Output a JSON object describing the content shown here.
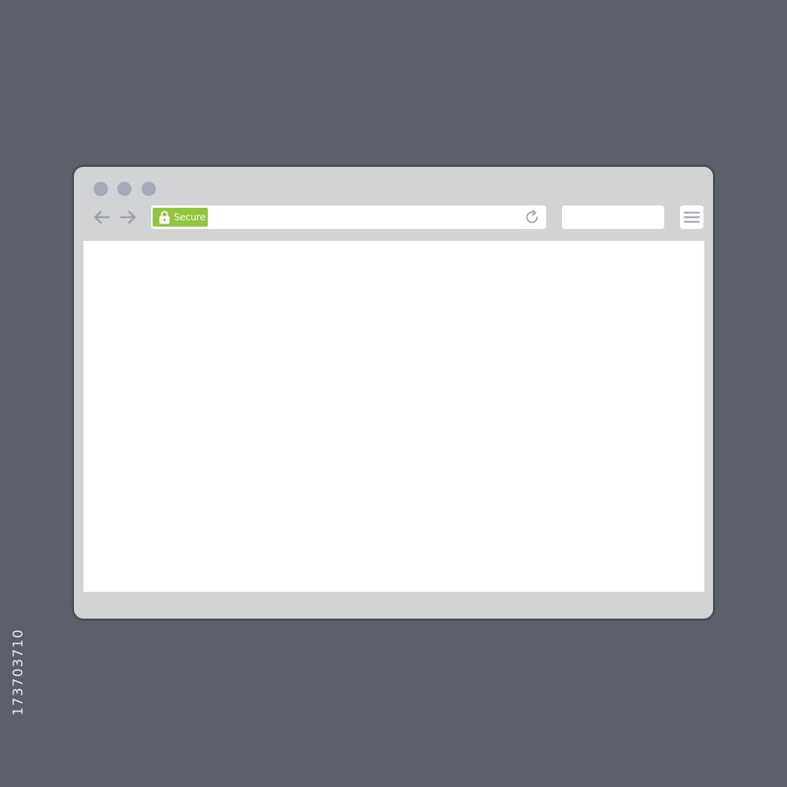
{
  "browser": {
    "window_controls": [
      "close",
      "minimize",
      "maximize"
    ],
    "back_icon": "arrow-left-icon",
    "forward_icon": "arrow-right-icon",
    "address_bar": {
      "secure_label": "Secure",
      "secure_icon": "lock-icon",
      "url": "",
      "reload_icon": "reload-icon"
    },
    "search": {
      "value": ""
    },
    "menu_icon": "hamburger-menu-icon"
  },
  "stock_id": "173703710",
  "colors": {
    "background": "#5c606a",
    "chrome": "#d1d3d5",
    "window_dot": "#a4aab9",
    "nav_arrow": "#9aa0ae",
    "secure_badge": "#8fc63c",
    "content": "#ffffff"
  }
}
